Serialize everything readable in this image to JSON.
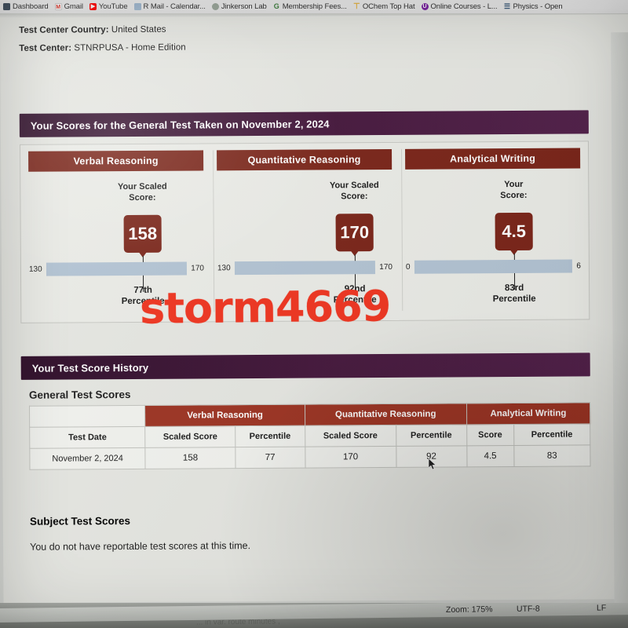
{
  "browser": {
    "bookmarks": [
      {
        "label": "Dashboard",
        "icon": "dashboard-icon"
      },
      {
        "label": "Gmail",
        "icon": "gmail-icon"
      },
      {
        "label": "YouTube",
        "icon": "youtube-icon"
      },
      {
        "label": "R Mail - Calendar...",
        "icon": "calendar-icon"
      },
      {
        "label": "Jinkerson Lab",
        "icon": "flask-icon"
      },
      {
        "label": "Membership Fees...",
        "icon": "google-icon"
      },
      {
        "label": "OChem Top Hat",
        "icon": "tophat-icon"
      },
      {
        "label": "Online Courses - L...",
        "icon": "udemy-icon"
      },
      {
        "label": "Physics - Open",
        "icon": "book-icon"
      }
    ]
  },
  "meta": {
    "country_label": "Test Center Country:",
    "country_value": "United States",
    "center_label": "Test Center:",
    "center_value": "STNRPUSA - Home Edition"
  },
  "scores_banner": "Your Scores for the General Test Taken on November 2, 2024",
  "cards": [
    {
      "title": "Verbal Reasoning",
      "score_label": "Your Scaled\nScore:",
      "score_label_line1": "Your Scaled",
      "score_label_line2": "Score:",
      "score": "158",
      "scale_min": "130",
      "scale_max": "170",
      "percentile_line1": "77th",
      "percentile_line2": "Percentile",
      "marker_pct": 70
    },
    {
      "title": "Quantitative Reasoning",
      "score_label_line1": "Your Scaled",
      "score_label_line2": "Score:",
      "score": "170",
      "scale_min": "130",
      "scale_max": "170",
      "percentile_line1": "92nd",
      "percentile_line2": "Percentile",
      "marker_pct": 100
    },
    {
      "title": "Analytical Writing",
      "score_label_line1": "Your",
      "score_label_line2": "Score:",
      "score": "4.5",
      "scale_min": "0",
      "scale_max": "6",
      "percentile_line1": "83rd",
      "percentile_line2": "Percentile",
      "marker_pct": 75
    }
  ],
  "history_banner": "Your Test Score History",
  "general_heading": "General Test Scores",
  "table": {
    "group_headers": [
      "Verbal Reasoning",
      "Quantitative Reasoning",
      "Analytical Writing"
    ],
    "date_header": "Test Date",
    "sub_headers": [
      "Scaled Score",
      "Percentile",
      "Scaled Score",
      "Percentile",
      "Score",
      "Percentile"
    ],
    "rows": [
      {
        "date": "November 2, 2024",
        "values": [
          "158",
          "77",
          "170",
          "92",
          "4.5",
          "83"
        ]
      }
    ]
  },
  "subject_heading": "Subject Test Scores",
  "subject_message": "You do not have reportable test scores at this time.",
  "watermark": "storm4669",
  "status_bar": {
    "zoom": "Zoom: 175%",
    "encoding": "UTF-8",
    "eol": "LF",
    "ghost": "... in var. route   minutes  ,"
  },
  "colors": {
    "banner_purple": "#2d0c28",
    "card_red": "#7a2418",
    "table_header_red": "#9d3322",
    "scale_bar_blue": "#b3c4d4",
    "watermark_red": "#f0341f",
    "page_bg": "#e6e7e2"
  }
}
